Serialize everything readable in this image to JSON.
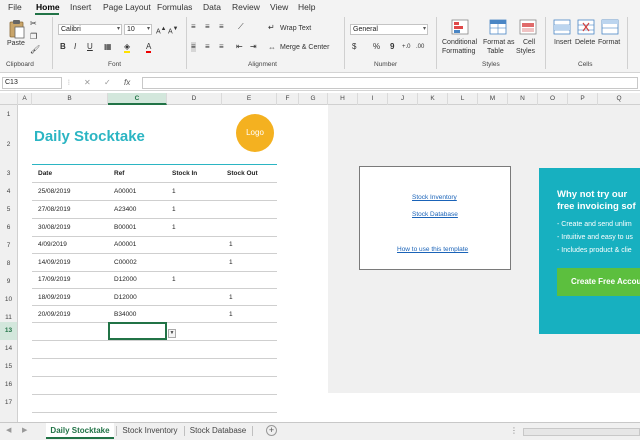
{
  "menu": {
    "items": [
      "File",
      "Home",
      "Insert",
      "Page Layout",
      "Formulas",
      "Data",
      "Review",
      "View",
      "Help"
    ],
    "active": "Home"
  },
  "ribbon": {
    "clipboard": {
      "paste": "Paste",
      "label": "Clipboard"
    },
    "font": {
      "font_name": "Calibri",
      "font_size": "10",
      "label": "Font"
    },
    "alignment": {
      "wrap_text": "Wrap Text",
      "merge_center": "Merge & Center",
      "label": "Alignment"
    },
    "number": {
      "format": "General",
      "label": "Number"
    },
    "styles": {
      "conditional_formatting_1": "Conditional",
      "conditional_formatting_2": "Formatting",
      "format_as_table_1": "Format as",
      "format_as_table_2": "Table",
      "cell_styles_1": "Cell",
      "cell_styles_2": "Styles",
      "label": "Styles"
    },
    "cells": {
      "insert": "Insert",
      "delete": "Delete",
      "format": "Format",
      "label": "Cells"
    }
  },
  "formula_bar": {
    "name_box": "C13",
    "fx": "fx",
    "cancel": "✕",
    "enter": "✓",
    "value": ""
  },
  "columns": [
    "A",
    "B",
    "C",
    "D",
    "E",
    "F",
    "G",
    "H",
    "I",
    "J",
    "K",
    "L",
    "M",
    "N",
    "O",
    "P",
    "Q"
  ],
  "selected_column": "C",
  "rows": [
    "1",
    "2",
    "3",
    "4",
    "5",
    "6",
    "7",
    "8",
    "9",
    "10",
    "11",
    "12",
    "13",
    "14",
    "15",
    "16",
    "17"
  ],
  "selected_row": "13",
  "sheet": {
    "title": "Daily Stocktake",
    "logo": "Logo",
    "headers": {
      "date": "Date",
      "ref": "Ref",
      "stock_in": "Stock In",
      "stock_out": "Stock Out"
    },
    "entries": [
      {
        "date": "25/08/2019",
        "ref": "A00001",
        "stock_in": "1",
        "stock_out": ""
      },
      {
        "date": "27/08/2019",
        "ref": "A23400",
        "stock_in": "1",
        "stock_out": ""
      },
      {
        "date": "30/08/2019",
        "ref": "B00001",
        "stock_in": "1",
        "stock_out": ""
      },
      {
        "date": "4/09/2019",
        "ref": "A00001",
        "stock_in": "",
        "stock_out": "1"
      },
      {
        "date": "14/09/2019",
        "ref": "C00002",
        "stock_in": "",
        "stock_out": "1"
      },
      {
        "date": "17/09/2019",
        "ref": "D12000",
        "stock_in": "1",
        "stock_out": ""
      },
      {
        "date": "18/09/2019",
        "ref": "D12000",
        "stock_in": "",
        "stock_out": "1"
      },
      {
        "date": "20/09/2019",
        "ref": "B34000",
        "stock_in": "",
        "stock_out": "1"
      }
    ]
  },
  "navigation": {
    "stock_inventory": "Stock Inventory",
    "stock_database": "Stock Database",
    "how_to": "How to use this template"
  },
  "promo": {
    "headline_1": "Why not try our",
    "headline_2": "free invoicing sof",
    "bullets": [
      "- Create and send unlim",
      "- Intuitive and easy to us",
      "- Includes product & clie"
    ],
    "cta": "Create Free Accou"
  },
  "tabs": [
    "Daily Stocktake",
    "Stock Inventory",
    "Stock Database"
  ],
  "active_tab": "Daily Stocktake",
  "add_sheet": "+",
  "colors": {
    "accent": "#217346",
    "title_teal": "#2bb5c3",
    "logo": "#f4b120",
    "promo_bg": "#17b0c0",
    "cta": "#5cbf3e"
  }
}
